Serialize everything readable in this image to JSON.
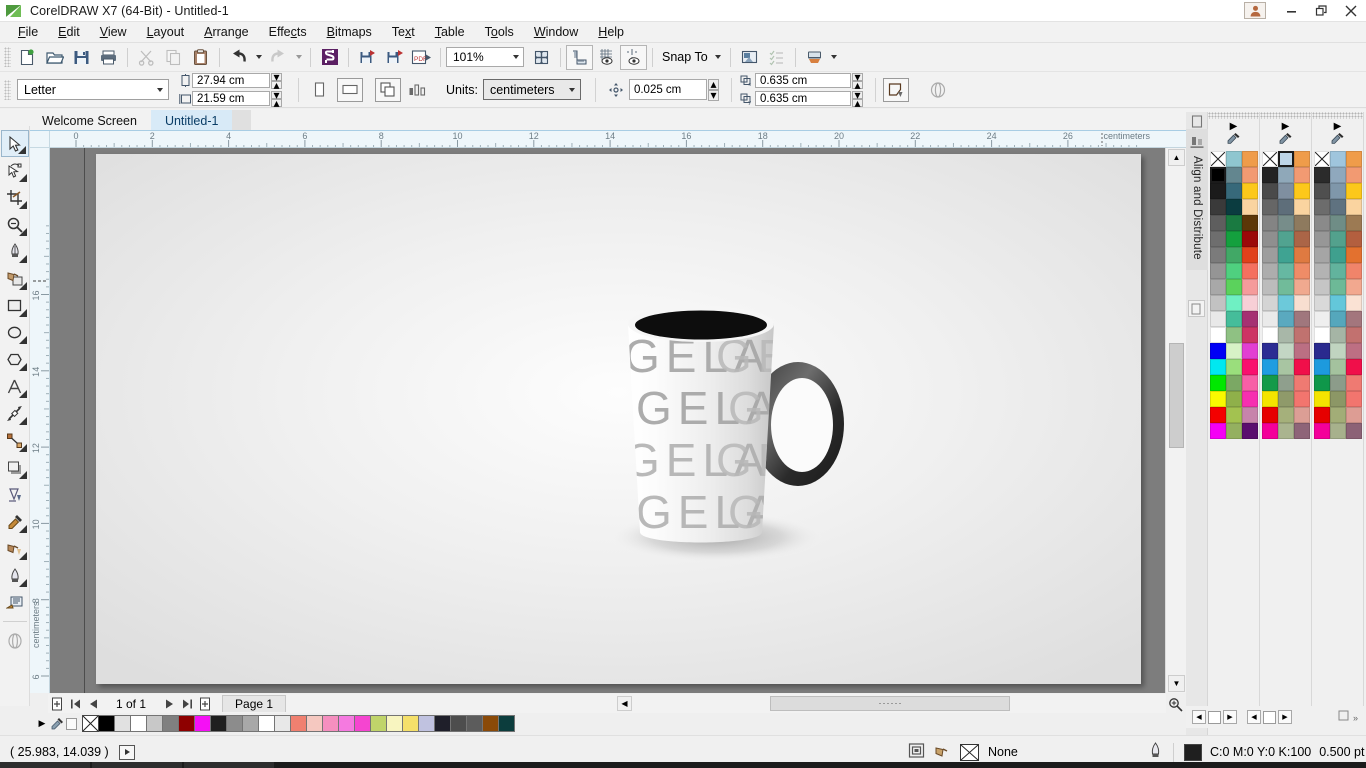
{
  "window": {
    "title": "CorelDRAW X7 (64-Bit) - Untitled-1",
    "logo_icon": "coreldraw-logo-icon",
    "account_icon": "user-account-icon",
    "minimize_label": "–",
    "restore_label": "❐",
    "close_label": "✕"
  },
  "menubar": [
    {
      "label": "File",
      "accel": "F"
    },
    {
      "label": "Edit",
      "accel": "E"
    },
    {
      "label": "View",
      "accel": "V"
    },
    {
      "label": "Layout",
      "accel": "L"
    },
    {
      "label": "Arrange",
      "accel": "A"
    },
    {
      "label": "Effects",
      "accel": "c"
    },
    {
      "label": "Bitmaps",
      "accel": "B"
    },
    {
      "label": "Text",
      "accel": "x"
    },
    {
      "label": "Table",
      "accel": "T"
    },
    {
      "label": "Tools",
      "accel": "o"
    },
    {
      "label": "Window",
      "accel": "W"
    },
    {
      "label": "Help",
      "accel": "H"
    }
  ],
  "toolbar": {
    "new_icon": "new-document-icon",
    "open_icon": "open-folder-icon",
    "save_icon": "save-disk-icon",
    "print_icon": "print-icon",
    "cut_icon": "scissors-cut-icon",
    "copy_icon": "copy-icon",
    "paste_icon": "paste-clipboard-icon",
    "undo_icon": "undo-arrow-icon",
    "redo_icon": "redo-arrow-icon",
    "import_icon": "import-icon",
    "export_icon": "export-icon",
    "publish_pdf_icon": "publish-to-pdf-icon",
    "corel_connect_icon": "corel-connect-icon",
    "zoom_level": "101%",
    "zoom_dropdown_icon": "chevron-down-icon",
    "fullscreen_icon": "full-screen-preview-icon",
    "show_rulers_icon": "show-rulers-icon",
    "show_grid_icon": "show-grid-icon",
    "show_guides_icon": "show-guidelines-icon",
    "snap_to_label": "Snap To",
    "snap_dropdown_icon": "chevron-down-icon",
    "options_icon": "options-icon",
    "object_manager_icon": "object-manager-icon",
    "application_launcher_icon": "application-launcher-icon",
    "launcher_dropdown_icon": "chevron-down-icon"
  },
  "propbar": {
    "page_size": "Letter",
    "page_size_dropdown_icon": "chevron-down-icon",
    "width_icon": "page-width-icon",
    "width_value": "27.94 cm",
    "height_icon": "page-height-icon",
    "height_value": "21.59 cm",
    "portrait_icon": "portrait-orientation-icon",
    "landscape_icon": "landscape-orientation-icon",
    "all_pages_icon": "apply-to-all-pages-icon",
    "current_page_icon": "apply-to-current-page-icon",
    "units_label": "Units:",
    "units_value": "centimeters",
    "units_dropdown_icon": "chevron-down-icon",
    "nudge_icon": "nudge-offset-icon",
    "nudge_value": "0.025 cm",
    "duplicate_x_icon": "duplicate-distance-x-icon",
    "duplicate_x_value": "0.635 cm",
    "duplicate_y_icon": "duplicate-distance-y-icon",
    "duplicate_y_value": "0.635 cm",
    "treat_as_filled_icon": "treat-all-objects-as-filled-icon",
    "wireframe_icon": "wireframe-icon"
  },
  "doctabs": {
    "tabs": [
      {
        "label": "Welcome Screen",
        "active": false
      },
      {
        "label": "Untitled-1",
        "active": true
      },
      {
        "label": "",
        "active": false
      }
    ]
  },
  "toolbox": [
    {
      "name": "pick-tool-icon",
      "selected": true,
      "flyout": true
    },
    {
      "name": "shape-tool-icon",
      "selected": false,
      "flyout": true
    },
    {
      "name": "crop-tool-icon",
      "selected": false,
      "flyout": true
    },
    {
      "name": "zoom-tool-icon",
      "selected": false,
      "flyout": true
    },
    {
      "name": "freehand-pen-tool-icon",
      "selected": false,
      "flyout": true
    },
    {
      "name": "smart-fill-tool-icon",
      "selected": false,
      "flyout": true
    },
    {
      "name": "rectangle-tool-icon",
      "selected": false,
      "flyout": true
    },
    {
      "name": "ellipse-tool-icon",
      "selected": false,
      "flyout": true
    },
    {
      "name": "polygon-tool-icon",
      "selected": false,
      "flyout": true
    },
    {
      "name": "text-tool-icon",
      "selected": false,
      "flyout": true
    },
    {
      "name": "parallel-dimension-tool-icon",
      "selected": false,
      "flyout": true
    },
    {
      "name": "straight-line-connector-tool-icon",
      "selected": false,
      "flyout": true
    },
    {
      "name": "drop-shadow-tool-icon",
      "selected": false,
      "flyout": true
    },
    {
      "name": "transparency-tool-icon",
      "selected": false,
      "flyout": false
    },
    {
      "name": "color-eyedropper-tool-icon",
      "selected": false,
      "flyout": true
    },
    {
      "name": "fill-tool-icon",
      "selected": false,
      "flyout": true
    },
    {
      "name": "interactive-fill-tool-icon",
      "selected": false,
      "flyout": true
    },
    {
      "name": "smart-drawing-tool-icon",
      "selected": false,
      "flyout": false
    },
    {
      "name": "wireframe-preview-icon",
      "selected": false,
      "flyout": false
    }
  ],
  "rulers": {
    "unit_label": "centimeters",
    "h_labels": [
      "0",
      "2",
      "4",
      "6",
      "8",
      "10",
      "12",
      "14",
      "16",
      "18",
      "20",
      "22",
      "24",
      "26"
    ],
    "v_labels": [
      "6",
      "8",
      "10",
      "12",
      "14",
      "16"
    ]
  },
  "canvas": {
    "artwork_name": "coffee-mug-artwork",
    "mug_text": "GELAS",
    "mug_rows": 4
  },
  "pagenav": {
    "add_page_start_icon": "add-page-before-icon",
    "first_icon": "first-page-icon",
    "prev_icon": "previous-page-icon",
    "count_label": "1 of 1",
    "next_icon": "next-page-icon",
    "last_icon": "last-page-icon",
    "add_page_end_icon": "add-page-after-icon",
    "page_tab_label": "Page 1"
  },
  "statusbar": {
    "coordinates": "( 25.983, 14.039 )",
    "play_icon": "play-macro-icon",
    "fill_icon": "fill-color-icon",
    "outline_swatch_icon": "outline-swatch-icon",
    "fill_value": "None",
    "outline_icon": "outline-pen-icon",
    "outline_color": "#1f1f1f",
    "outline_color_value": "C:0 M:0 Y:0 K:100",
    "outline_width": "0.500 pt"
  },
  "docker": {
    "align_icon": "align-and-distribute-icon",
    "title": "Align and Distribute",
    "collapse_icon": "collapse-docker-icon",
    "palette_columns": [
      {
        "arrow_icon": "palette-scroll-arrow-icon",
        "eyedropper_icon": "eyedropper-icon"
      },
      {
        "arrow_icon": "palette-scroll-arrow-icon",
        "eyedropper_icon": "eyedropper-icon"
      },
      {
        "arrow_icon": "palette-scroll-arrow-icon",
        "eyedropper_icon": "eyedropper-icon"
      }
    ],
    "footer_icons": [
      "palette-prev-icon",
      "palette-swatch-icon",
      "palette-next-icon",
      "palette-scroll-left-icon",
      "palette-swatch2-icon",
      "palette-scroll-right-icon",
      "palette-expand-icon"
    ]
  },
  "palettes": {
    "docker_col1": [
      "none",
      "#8fc6cf",
      "#ef9c4a",
      "#000000",
      "#63868f",
      "#f29a72",
      "#1b1b1b",
      "#37697a",
      "#fcc81b",
      "#3a3a3a",
      "#0b3c40",
      "#fad4a0",
      "#5e5e5e",
      "#1a7a41",
      "#5c3708",
      "#6e6e6e",
      "#14a03e",
      "#9b0909",
      "#7b7b7b",
      "#41a866",
      "#e0411b",
      "#959595",
      "#4fd07f",
      "#f4705f",
      "#a8a8a8",
      "#5bd25c",
      "#f59b9b",
      "#c2c2c2",
      "#6ff0c3",
      "#f7cfd6",
      "#e9e9e9",
      "#45bd9a",
      "#a53172",
      "#ffffff",
      "#8fc183",
      "#cd3464",
      "#0000f5",
      "#d7f2c6",
      "#e23fd2",
      "#00e8f0",
      "#9ade7c",
      "#f9106e",
      "#00e800",
      "#7ba864",
      "#f75fa6",
      "#f9f900",
      "#8fb04a",
      "#f62fb0",
      "#f40000",
      "#a3c250",
      "#c784ab",
      "#f500f5",
      "#94b060",
      "#5a0d6e"
    ],
    "docker_col2": [
      "none",
      "#bdd5e7",
      "#ef9c4a",
      "#232323",
      "#8fa8b9",
      "#f29a72",
      "#4a4a4a",
      "#7f8fa0",
      "#fcc81b",
      "#666666",
      "#5e6e7a",
      "#fad4a0",
      "#848484",
      "#778d8a",
      "#8e7a5e",
      "#8f8f8f",
      "#51a390",
      "#ab6547",
      "#9d9d9d",
      "#3fa392",
      "#df7a41",
      "#adadad",
      "#66b8a2",
      "#ef8c67",
      "#bcbcbc",
      "#71bb9a",
      "#f0a98f",
      "#d4d4d4",
      "#6cc9da",
      "#f8ded0",
      "#eaeaea",
      "#5aa9bf",
      "#a0777d",
      "#ffffff",
      "#a8b7a8",
      "#c0726f",
      "#2c2c93",
      "#c3d6c4",
      "#bb6f83",
      "#1f9de0",
      "#a8c5a2",
      "#f00f4a",
      "#149a49",
      "#8f9f8d",
      "#ef7a72",
      "#f4e400",
      "#8f9a6a",
      "#f2756e",
      "#e60000",
      "#a5b07b",
      "#dc9e95",
      "#f4009a",
      "#aab48f",
      "#8e6478"
    ],
    "docker_col3": [
      "none",
      "#9fc5dd",
      "#ef9c4a",
      "#2b2b2b",
      "#8fa8bd",
      "#f29a72",
      "#4f4f4f",
      "#7f97aa",
      "#fcc81b",
      "#6c6c6c",
      "#5f7280",
      "#fad4a0",
      "#8a8a8a",
      "#6f8d86",
      "#9c7a53",
      "#979797",
      "#53a18d",
      "#b35f3f",
      "#a5a5a5",
      "#3fa08e",
      "#e3712f",
      "#b3b3b3",
      "#62b39d",
      "#f0846a",
      "#c5c5c5",
      "#6db997",
      "#f2a88f",
      "#d9d9d9",
      "#63c7da",
      "#fae2d4",
      "#efefef",
      "#55a7bc",
      "#a3767d",
      "#ffffff",
      "#a5b5a5",
      "#c2716f",
      "#2a2a8e",
      "#c0d4c0",
      "#bd6f83",
      "#1d9add",
      "#a4c29e",
      "#f00f4a",
      "#0f974a",
      "#8c9c8a",
      "#ef7a72",
      "#f4e400",
      "#8c9766",
      "#f2756e",
      "#e60000",
      "#a2ad77",
      "#dd9d94",
      "#f4009a",
      "#a7b18c",
      "#8c6276"
    ],
    "bottom_strip": [
      "none",
      "#000000",
      "#e1e1e1",
      "#ffffff",
      "#c8c8c8",
      "#808080",
      "#8e0000",
      "#f510f5",
      "#1f1f1f",
      "#8c8c8c",
      "#a8a8a8",
      "#ffffff",
      "#e8e8e8",
      "#f08070",
      "#f5c8c0",
      "#f58fbf",
      "#f57ae0",
      "#f545d0",
      "#c0d46a",
      "#f8f5c0",
      "#f5e06a",
      "#c0c2e0",
      "#1f1f2a",
      "#4d4d4d",
      "#5c5c5c",
      "#8a4a08",
      "#0c3d3d"
    ]
  }
}
